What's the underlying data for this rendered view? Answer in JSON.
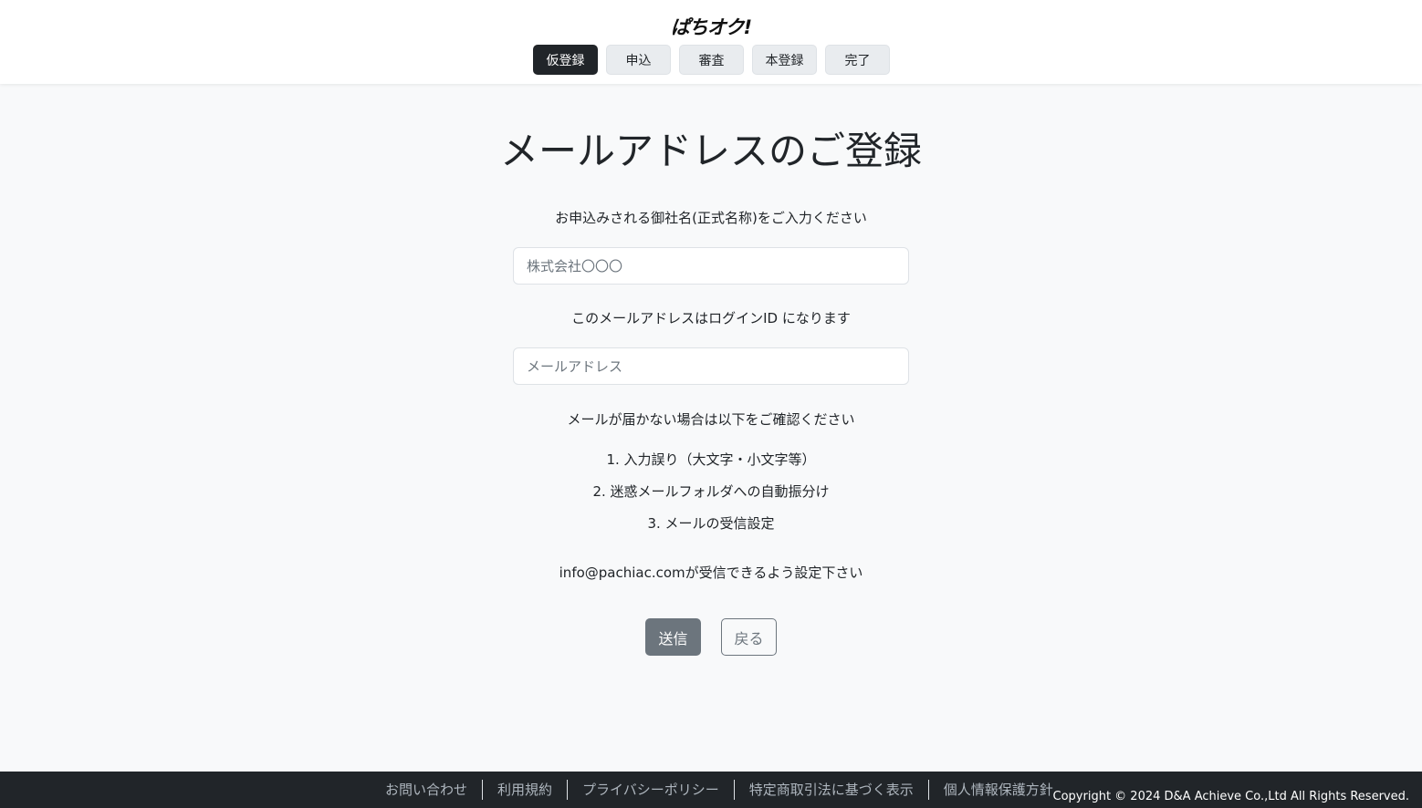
{
  "header": {
    "logo_text": "ぱちオク!",
    "steps": [
      {
        "label": "仮登録",
        "active": true
      },
      {
        "label": "申込",
        "active": false
      },
      {
        "label": "審査",
        "active": false
      },
      {
        "label": "本登録",
        "active": false
      },
      {
        "label": "完了",
        "active": false
      }
    ]
  },
  "main": {
    "title": "メールアドレスのご登録",
    "company_label": "お申込みされる御社名(正式名称)をご入力ください",
    "company_placeholder": "株式会社〇〇〇",
    "email_label": "このメールアドレスはログインID になります",
    "email_placeholder": "メールアドレス",
    "notice_heading": "メールが届かない場合は以下をご確認ください",
    "notice_items": [
      "1. 入力誤り（大文字・小文字等）",
      "2. 迷惑メールフォルダへの自動振分け",
      "3. メールの受信設定"
    ],
    "info_text": "info@pachiac.comが受信できるよう設定下さい",
    "send_label": "送信",
    "back_label": "戻る"
  },
  "footer": {
    "links": [
      "お問い合わせ",
      "利用規約",
      "プライバシーポリシー",
      "特定商取引法に基づく表示",
      "個人情報保護方針"
    ],
    "copyright": "Copyright © 2024 D&A Achieve Co.,Ltd All Rights Reserved."
  },
  "colors": {
    "active_step": "#212529",
    "inactive_step": "#e9ecef",
    "send_button": "#6c757d",
    "footer_bg": "#212529",
    "page_bg": "#f8f9fa"
  }
}
